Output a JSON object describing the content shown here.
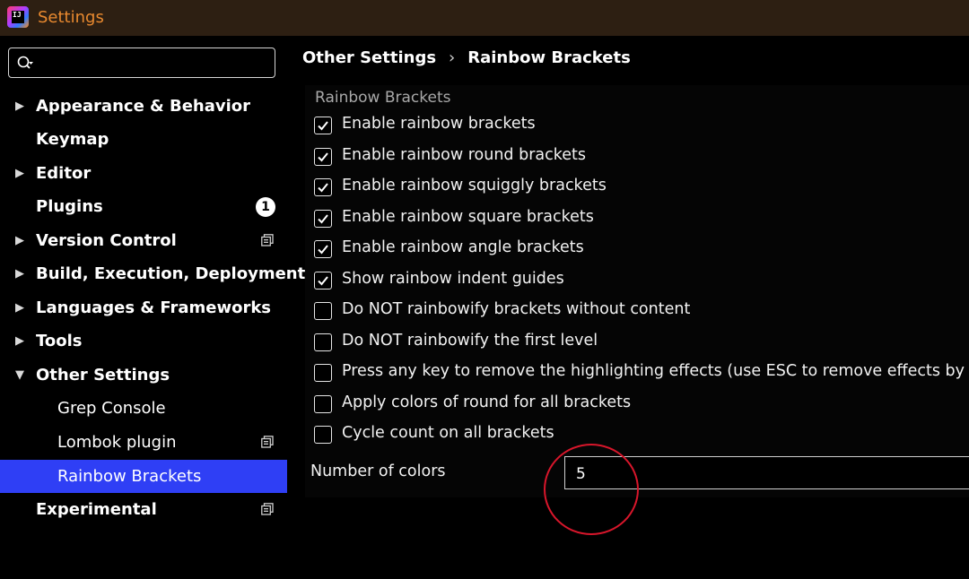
{
  "window": {
    "logo_text": "IJ",
    "title": "Settings"
  },
  "search": {
    "value": "",
    "placeholder": ""
  },
  "sidebar": {
    "items": [
      {
        "label": "Appearance & Behavior",
        "arrow": "▶"
      },
      {
        "label": "Keymap"
      },
      {
        "label": "Editor",
        "arrow": "▶"
      },
      {
        "label": "Plugins",
        "badge": "1"
      },
      {
        "label": "Version Control",
        "arrow": "▶"
      },
      {
        "label": "Build, Execution, Deployment",
        "arrow": "▶"
      },
      {
        "label": "Languages & Frameworks",
        "arrow": "▶"
      },
      {
        "label": "Tools",
        "arrow": "▶"
      },
      {
        "label": "Other Settings",
        "arrow": "▼"
      },
      {
        "label": "Grep Console"
      },
      {
        "label": "Lombok plugin"
      },
      {
        "label": "Rainbow Brackets",
        "selected": true
      },
      {
        "label": "Experimental"
      }
    ]
  },
  "breadcrumb": {
    "parent": "Other Settings",
    "separator": "›",
    "current": "Rainbow Brackets"
  },
  "panel": {
    "section_title": "Rainbow Brackets",
    "options": [
      {
        "label": "Enable rainbow brackets",
        "checked": true
      },
      {
        "label": "Enable rainbow round brackets",
        "checked": true
      },
      {
        "label": "Enable rainbow squiggly brackets",
        "checked": true
      },
      {
        "label": "Enable rainbow square brackets",
        "checked": true
      },
      {
        "label": "Enable rainbow angle brackets",
        "checked": true
      },
      {
        "label": "Show rainbow indent guides",
        "checked": true
      },
      {
        "label": "Do NOT rainbowify brackets without content",
        "checked": false
      },
      {
        "label": "Do NOT rainbowify the first level",
        "checked": false
      },
      {
        "label": "Press any key to remove the highlighting effects (use ESC to remove effects by default)",
        "checked": false
      },
      {
        "label": "Apply colors of round for all brackets",
        "checked": false
      },
      {
        "label": "Cycle count on all brackets",
        "checked": false
      }
    ],
    "number_of_colors_label": "Number of colors",
    "number_of_colors_value": "5"
  },
  "colors": {
    "accent_selected": "#2f3ff5",
    "title_text": "#e8892f",
    "annotation": "#d8162b"
  }
}
